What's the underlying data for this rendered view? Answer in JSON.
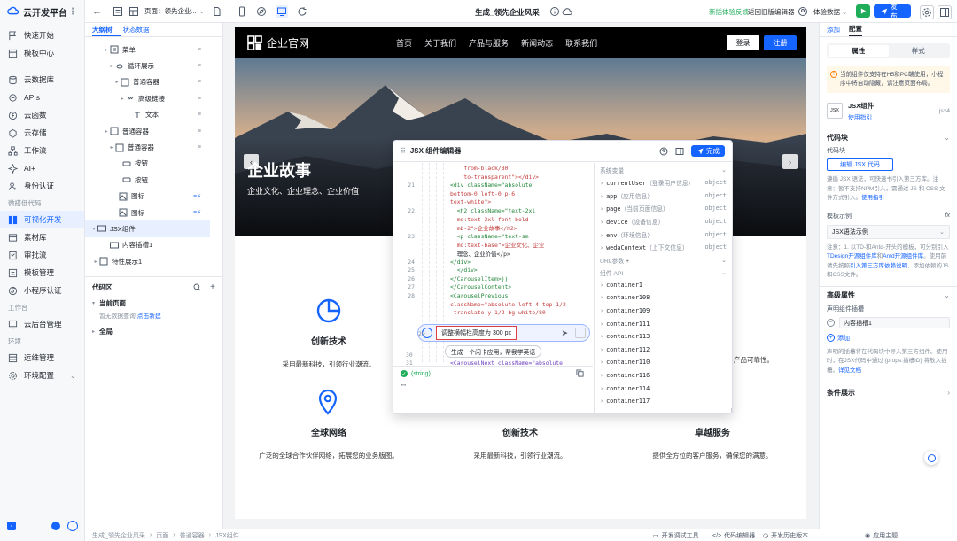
{
  "app": {
    "brand": "云开发平台",
    "page_label": "页面：领先企业...",
    "doc_title": "生成_领先企业风采",
    "feedback": "新插体验反馈",
    "back_old": "返回旧版编辑器",
    "data_label": "体验数据",
    "publish": "发布"
  },
  "nav": {
    "items_top": [
      "快速开始",
      "模板中心"
    ],
    "items_mid": [
      "云数据库",
      "APIs",
      "云函数",
      "云存储",
      "工作流",
      "AI+",
      "身份认证"
    ],
    "group_lowcode": "微搭低代码",
    "items_lowcode": [
      "可视化开发",
      "素材库",
      "审批流",
      "模板管理",
      "小程序认证"
    ],
    "group_workbench": "工作台",
    "items_workbench": [
      "云后台管理"
    ],
    "group_env": "环境",
    "items_env": [
      "运维管理",
      "环境配置"
    ]
  },
  "tree": {
    "tab_outline": "大纲树",
    "tab_state": "状态数据",
    "nodes": [
      {
        "label": "菜单"
      },
      {
        "label": "循环展示"
      },
      {
        "label": "普通容器"
      },
      {
        "label": "高级链接"
      },
      {
        "label": "文本"
      },
      {
        "label": "普通容器"
      },
      {
        "label": "普通容器"
      },
      {
        "label": "按钮"
      },
      {
        "label": "按钮"
      },
      {
        "label": "图标"
      },
      {
        "label": "图标"
      },
      {
        "label": "JSX组件"
      },
      {
        "label": "内容插槽1"
      },
      {
        "label": "特性展示1"
      }
    ],
    "code_area": "代码区",
    "current_page": "当前页面",
    "no_data": "暂无数据查询,",
    "create_link": "点击新建",
    "global": "全局"
  },
  "site": {
    "logo_text": "企业官网",
    "menu": [
      "首页",
      "关于我们",
      "产品与服务",
      "新闻动态",
      "联系我们"
    ],
    "login": "登录",
    "register": "注册",
    "hero_title": "企业故事",
    "hero_sub": "企业文化、企业理念、企业价值",
    "features_row1": [
      {
        "title": "创新技术",
        "desc": "采用最新科技，引领行业潮流。"
      }
    ],
    "partial_right": "产品可靠性。",
    "features_row2": [
      {
        "title": "全球网络",
        "desc": "广泛的全球合作伙伴网络，拓展您的业务版图。"
      },
      {
        "title": "创新技术",
        "desc": "采用最新科技，引领行业潮流。"
      },
      {
        "title": "卓越服务",
        "desc": "提供全方位的客户服务，确保您的满意。"
      }
    ]
  },
  "jsx": {
    "title": "JSX 组件编辑器",
    "done": "完成",
    "code_lines": [
      {
        "n": "",
        "t": "    from-black/80"
      },
      {
        "n": "",
        "t": "    to-transparent\"></div>"
      },
      {
        "n": "21",
        "t": "<div className=\"absolute"
      },
      {
        "n": "",
        "t": "bottom-0 left-0 p-6"
      },
      {
        "n": "",
        "t": "text-white\">"
      },
      {
        "n": "22",
        "t": "  <h2 className=\"text-2xl"
      },
      {
        "n": "",
        "t": "  md:text-3xl font-bold"
      },
      {
        "n": "",
        "t": "  mb-2\">企业故事</h2>"
      },
      {
        "n": "23",
        "t": "  <p className=\"text-sm"
      },
      {
        "n": "",
        "t": "  md:text-base\">企业文化、企业"
      },
      {
        "n": "",
        "t": "  理念、企业价值</p>"
      },
      {
        "n": "24",
        "t": "</div>"
      },
      {
        "n": "25",
        "t": "  </div>"
      },
      {
        "n": "26",
        "t": "</CarouselItem>))"
      },
      {
        "n": "27",
        "t": "</CarouselContent>"
      },
      {
        "n": "28",
        "t": "<CarouselPrevious"
      },
      {
        "n": "",
        "t": "className=\"absolute left-4 top-1/2"
      },
      {
        "n": "",
        "t": "-translate-y-1/2 bg-white/80"
      }
    ],
    "ai_prompt": "调整横幅栏高度为 300 px",
    "ai_suggest": "生成一个闪卡应用，帮我学英语",
    "line29": "29",
    "line30": "30",
    "line31": "31",
    "line31_text": "<CarouselNext className=\"absolute",
    "result": "(string)",
    "result_more": "\"\"",
    "var_section": "系统变量",
    "vars": [
      {
        "name": "currentUser",
        "hint": "（登录用户信息）",
        "type": "object"
      },
      {
        "name": "app",
        "hint": "（应用信息）",
        "type": "object"
      },
      {
        "name": "page",
        "hint": "（当前页面信息）",
        "type": "object"
      },
      {
        "name": "device",
        "hint": "（设备信息）",
        "type": "object"
      },
      {
        "name": "env",
        "hint": "（环境信息）",
        "type": "object"
      },
      {
        "name": "wedaContext",
        "hint": "（上下文信息）",
        "type": "object"
      }
    ],
    "url_params": "URL参数",
    "comp_api": "组件 API",
    "containers": [
      "container1",
      "container108",
      "container109",
      "container111",
      "container113",
      "container112",
      "container110",
      "container116",
      "container114",
      "container117"
    ]
  },
  "right": {
    "tab_add": "添加",
    "tab_config": "配置",
    "seg_props": "属性",
    "seg_style": "样式",
    "notice": "当前组件仅支持在H5和PC端使用，小程序中将自动隐藏，请注意页面布局。",
    "comp_name": "JSX组件",
    "comp_ver": "jsx4",
    "guide": "使用指引",
    "code_block": "代码块",
    "code_label": "代码块",
    "edit_code": "编辑 JSX 代码",
    "code_note_1": "遵循 JSX 语法，可快速书引入第三方库。注意：暂不支持NPM引入，需通过 JS 和 CSS 文件方式引入。",
    "code_note_link": "使用指引",
    "template_label": "模板示例",
    "template_value": "JSX语法示例",
    "template_note_1": "注意：1. 以TD-和Antd-开头的模板，可分别引入",
    "template_note_link1": "TDesign开源组件库",
    "template_note_and": "和",
    "template_note_link2": "Antd开源组件库",
    "template_note_2": "。使用前请先按照",
    "template_note_link3": "引入第三方库依赖说明",
    "template_note_3": "，添加依赖的JS和CSS文件。",
    "advanced": "高级属性",
    "slot_label": "声明组件插槽",
    "slot_value": "内容插槽1",
    "add": "添加",
    "slot_note": "声明的插槽将在代码块中导入第三方组件。使用时，在JSX代码中通过 {props.插槽ID} 将放入插槽。",
    "slot_note_link": "详见文档",
    "cond": "条件展示",
    "theme": "应用主题"
  },
  "status": {
    "crumbs": [
      "生成_领先企业风采",
      "页面",
      "普通容器",
      "JSX组件"
    ],
    "debug": "开发调试工具",
    "code_editor": "代码编辑器",
    "history": "开发历史版本"
  },
  "colors": {
    "accent": "#1664ff",
    "green": "#1fad5a"
  }
}
